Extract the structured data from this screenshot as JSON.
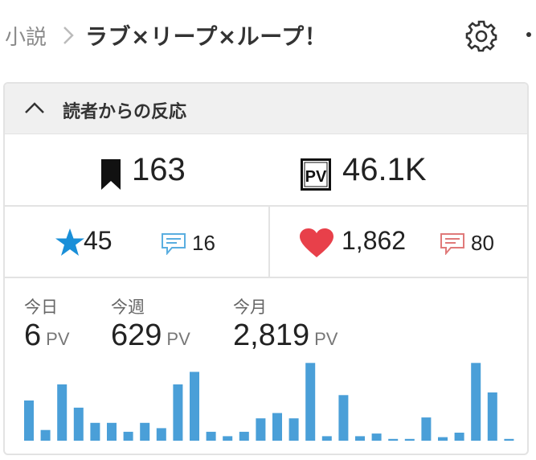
{
  "breadcrumb": {
    "root": "小説",
    "title": "ラブ×リープ×ループ！"
  },
  "card": {
    "title": "読者からの反応"
  },
  "summary": {
    "bookmarks": "163",
    "pv": "46.1K"
  },
  "reactions": {
    "stars": "45",
    "star_reviews": "16",
    "likes": "1,862",
    "like_comments": "80"
  },
  "stats": {
    "today_label": "今日",
    "today_value": "6",
    "week_label": "今週",
    "week_value": "629",
    "month_label": "今月",
    "month_value": "2,819",
    "unit": "PV"
  },
  "colors": {
    "bar": "#4a9fd8",
    "star": "#1a8fd8",
    "heart": "#e8404a",
    "review_blue": "#5aaee0",
    "review_red": "#e07a7a"
  },
  "chart_data": {
    "type": "bar",
    "values": [
      45,
      12,
      63,
      37,
      20,
      20,
      10,
      20,
      14,
      63,
      77,
      10,
      5,
      10,
      25,
      31,
      25,
      87,
      5,
      51,
      5,
      8,
      2,
      2,
      26,
      4,
      9,
      87,
      54,
      2
    ],
    "ylim": [
      0,
      90
    ]
  }
}
